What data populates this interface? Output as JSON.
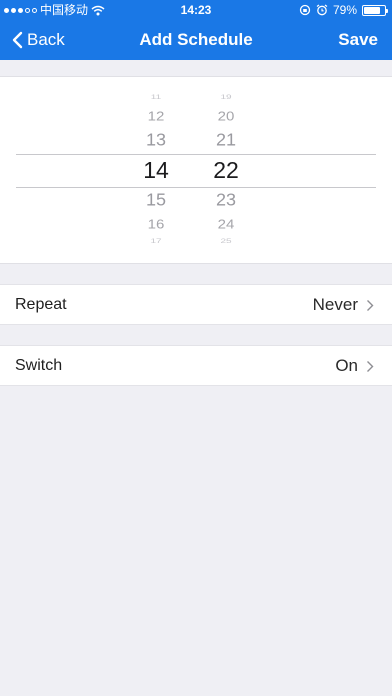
{
  "status_bar": {
    "carrier": "中国移动",
    "time": "14:23",
    "battery": "79%",
    "battery_level": 0.79,
    "signal_bars_filled": 3,
    "signal_bars_total": 5
  },
  "nav": {
    "back_label": "Back",
    "title": "Add Schedule",
    "save_label": "Save"
  },
  "picker": {
    "hours": [
      "11",
      "12",
      "13",
      "14",
      "15",
      "16",
      "17"
    ],
    "minutes": [
      "19",
      "20",
      "21",
      "22",
      "23",
      "24",
      "25"
    ],
    "selected_hour": "14",
    "selected_minute": "22"
  },
  "settings": {
    "repeat": {
      "label": "Repeat",
      "value": "Never"
    },
    "switch": {
      "label": "Switch",
      "value": "On"
    }
  },
  "colors": {
    "accent": "#1a78e6",
    "background": "#efeff4"
  }
}
